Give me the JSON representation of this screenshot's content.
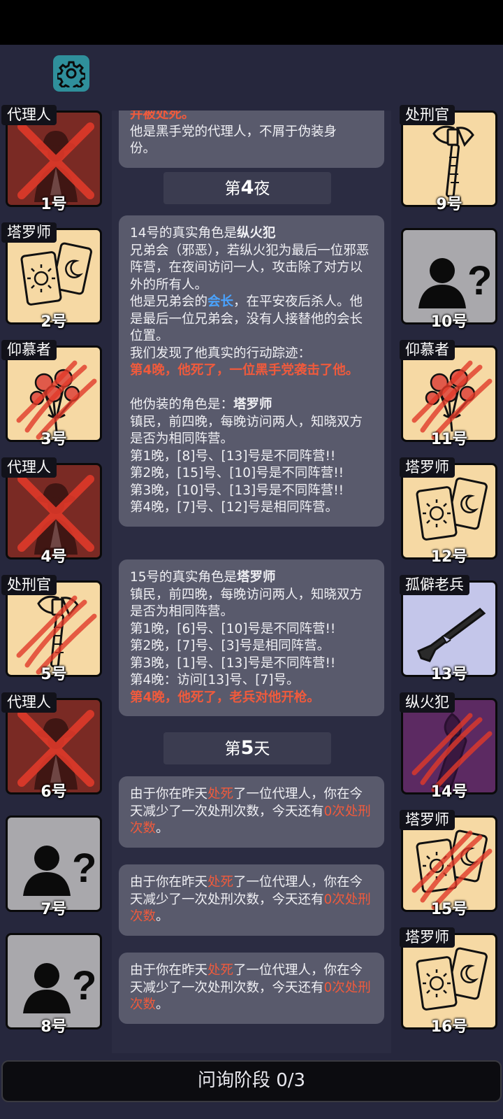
{
  "phase_label": "问询阶段 0/3",
  "left_players": [
    {
      "num": "1号",
      "role": "代理人",
      "style": "maroon",
      "icon": "mafia-agent-icon",
      "mark": "x"
    },
    {
      "num": "2号",
      "role": "塔罗师",
      "style": "cream",
      "icon": "tarot-cards-icon",
      "mark": "none"
    },
    {
      "num": "3号",
      "role": "仰慕者",
      "style": "cream",
      "icon": "rose-bouquet-icon",
      "mark": "slash"
    },
    {
      "num": "4号",
      "role": "代理人",
      "style": "maroon",
      "icon": "mafia-agent-icon",
      "mark": "x"
    },
    {
      "num": "5号",
      "role": "处刑官",
      "style": "cream",
      "icon": "axe-icon",
      "mark": "slash"
    },
    {
      "num": "6号",
      "role": "代理人",
      "style": "maroon",
      "icon": "mafia-agent-icon",
      "mark": "x"
    },
    {
      "num": "7号",
      "role": "",
      "style": "gray",
      "icon": "unknown-person-icon",
      "mark": "none"
    },
    {
      "num": "8号",
      "role": "",
      "style": "gray",
      "icon": "unknown-person-icon",
      "mark": "none"
    }
  ],
  "right_players": [
    {
      "num": "9号",
      "role": "处刑官",
      "style": "cream",
      "icon": "axe-icon",
      "mark": "none"
    },
    {
      "num": "10号",
      "role": "",
      "style": "gray",
      "icon": "unknown-person-icon",
      "mark": "none"
    },
    {
      "num": "11号",
      "role": "仰慕者",
      "style": "cream",
      "icon": "rose-bouquet-icon",
      "mark": "slash"
    },
    {
      "num": "12号",
      "role": "塔罗师",
      "style": "cream",
      "icon": "tarot-cards-icon",
      "mark": "none"
    },
    {
      "num": "13号",
      "role": "孤僻老兵",
      "style": "lav",
      "icon": "rifle-icon",
      "mark": "none"
    },
    {
      "num": "14号",
      "role": "纵火犯",
      "style": "purple",
      "icon": "torch-icon",
      "mark": "slash"
    },
    {
      "num": "15号",
      "role": "塔罗师",
      "style": "cream",
      "icon": "tarot-cards-icon",
      "mark": "slash"
    },
    {
      "num": "16号",
      "role": "塔罗师",
      "style": "cream",
      "icon": "tarot-cards-icon",
      "mark": "none"
    }
  ],
  "log": {
    "top_partial": {
      "cut_line": "并被处死。",
      "line1": "他是黑手党的代理人，不屑于伪装身",
      "line2": "份。"
    },
    "night4": {
      "prefix": "第",
      "n": "4",
      "suffix": "夜"
    },
    "entry14": {
      "a": "14号的真实角色是",
      "a_role": "纵火犯",
      "b": "兄弟会（邪恶），若纵火犯为最后一位邪恶阵营，在夜间访问一人，攻击除了对方以外的所有人。",
      "c1": "他是兄弟会的",
      "c_hl": "会长",
      "c2": "，在平安夜后杀人。他是最后一位兄弟会，没有人接替他的会长位置。",
      "d": "我们发现了他真实的行动踪迹：",
      "e": "第4晚，他死了，一位黑手党袭击了他。",
      "f": "他伪装的角色是：",
      "f_role": "塔罗师",
      "g": "镇民，前四晚，每晚访问两人，知晓双方是否为相同阵营。",
      "h1": "第1晚，[8]号、[13]号是不同阵营!!",
      "h2": "第2晚，[15]号、[10]号是不同阵营!!",
      "h3": "第3晚，[10]号、[13]号是不同阵营!!",
      "h4": "第4晚，[7]号、[12]号是相同阵营。"
    },
    "entry15": {
      "a": "15号的真实角色是",
      "a_role": "塔罗师",
      "b": "镇民，前四晚，每晚访问两人，知晓双方是否为相同阵营。",
      "h1": "第1晚，[6]号、[10]号是不同阵营!!",
      "h2": "第2晚，[7]号、[3]号是相同阵营。",
      "h3": "第3晚，[1]号、[13]号是不同阵营!!",
      "h4": "第4晚：访问[13]号、[7]号。",
      "e": "第4晚，他死了，老兵对他开枪。"
    },
    "day5": {
      "prefix": "第",
      "n": "5",
      "suffix": "天"
    },
    "notice": {
      "a": "由于你在昨天",
      "hl1": "处死",
      "b": "了一位代理人，你在今天减少了一次处刑次数，今天还有",
      "hl2": "0次处刑次数",
      "c": "。"
    }
  }
}
